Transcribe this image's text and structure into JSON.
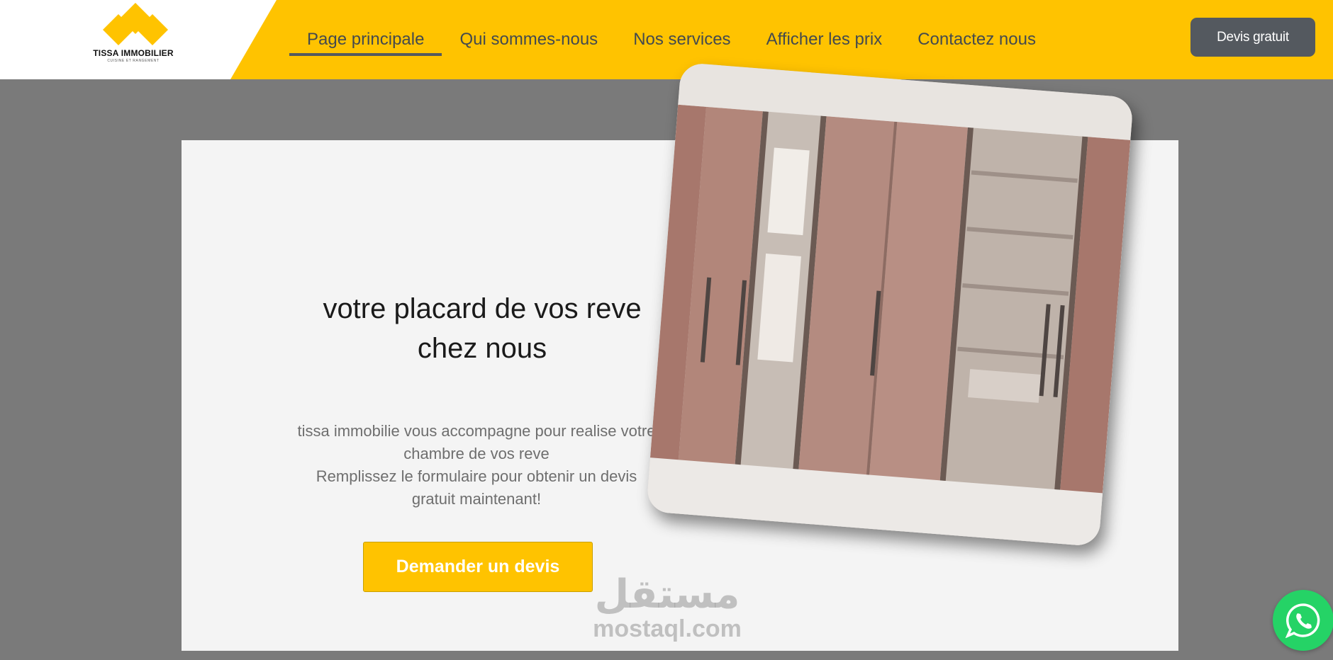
{
  "header": {
    "logo": {
      "name": "TISSA IMMOBILIER",
      "tagline": "CUISINE ET RANGEMENT",
      "color": "#ffc300"
    },
    "nav": [
      {
        "label": "Page principale",
        "active": true
      },
      {
        "label": "Qui sommes-nous",
        "active": false
      },
      {
        "label": "Nos services",
        "active": false
      },
      {
        "label": "Afficher les prix",
        "active": false
      },
      {
        "label": "Contactez nous",
        "active": false
      }
    ],
    "cta_label": "Devis gratuit"
  },
  "hero": {
    "title_line1": "votre placard de vos reve",
    "title_line2": "chez nous",
    "text_line1": "tissa immobilie vous accompagne pour realise votre",
    "text_line2": "chambre de vos reve",
    "text_line3": "Remplissez le formulaire pour obtenir un devis",
    "text_line4": "gratuit maintenant!",
    "button_label": "Demander un devis",
    "image_alt": "wardrobe-photo"
  },
  "watermark": {
    "arabic": "مستقل",
    "latin": "mostaql.com"
  },
  "whatsapp": {
    "icon": "whatsapp-icon",
    "color": "#25d366"
  },
  "colors": {
    "accent": "#ffc300",
    "dark": "#54595f",
    "backdrop": "#7a7a7a"
  }
}
